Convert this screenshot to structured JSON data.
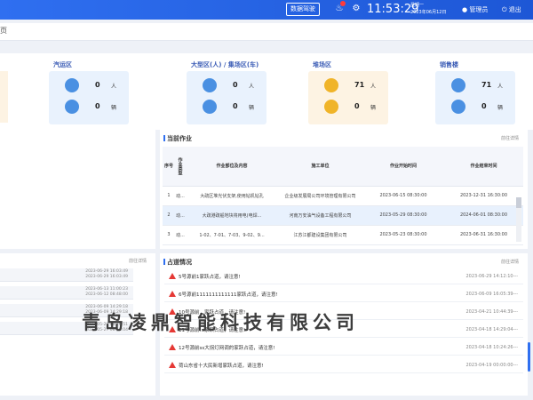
{
  "header": {
    "big_screen_label": "数据驾驶",
    "clock": "11:53:29",
    "date_line1": "星期一",
    "date_line2": "2023年06月12日",
    "user_label": "管理员",
    "exit_label": "退出",
    "brand_color": "#2f6ff0"
  },
  "tabbar": {
    "home_label": "页"
  },
  "stats": [
    {
      "title": "汽运区",
      "people": "0",
      "people_unit": "人",
      "vehicles": "0",
      "vehicles_unit": "辆",
      "card_color": "#e9f2fd",
      "icon_color": "#4a90e2"
    },
    {
      "title": "大型区(人) / 集场区(车)",
      "people": "0",
      "people_unit": "人",
      "vehicles": "0",
      "vehicles_unit": "辆",
      "card_color": "#e9f2fd",
      "icon_color": "#4a90e2"
    },
    {
      "title": "堆场区",
      "people": "71",
      "people_unit": "人",
      "vehicles": "0",
      "vehicles_unit": "辆",
      "card_color": "#fdf3e3",
      "icon_color": "#f0b429"
    },
    {
      "title": "销售楼",
      "people": "71",
      "people_unit": "人",
      "vehicles": "0",
      "vehicles_unit": "辆",
      "card_color": "#e9f2fd",
      "icon_color": "#4a90e2"
    }
  ],
  "current_work": {
    "title": "当前作业",
    "more": "前往详情",
    "columns": [
      "序号",
      "作业类型",
      "作业部位及内容",
      "施工单位",
      "作业开始时间",
      "作业结束时间"
    ],
    "rows": [
      {
        "no": "1",
        "type": "动...",
        "content": "大疏区堆光伏支架,使用钻机钻孔",
        "unit": "企业级发展局公司环境管理有限公司",
        "start": "2023-06-15 08:30:00",
        "end": "2023-12-31 16:30:00"
      },
      {
        "no": "2",
        "type": "动...",
        "content": "大疏港疏船地块将用电(电焊...",
        "unit": "河南万安油气设备工程有限公司",
        "start": "2023-05-29 08:30:00",
        "end": "2024-06-01 08:30:00"
      },
      {
        "no": "3",
        "type": "动...",
        "content": "1-02、7-01、7-03、9-02、9...",
        "unit": "江苏江都建设集团有限公司",
        "start": "2023-05-23 08:30:00",
        "end": "2023-06-31 16:30:00"
      }
    ]
  },
  "alarms": {
    "title": "占道情况",
    "more": "前往详情",
    "items": [
      {
        "text": "5号源前1家跃占道，请注意!",
        "time": "2023-06-29 14:12:10---"
      },
      {
        "text": "6号源前1111111111111家跃占道，请注意!",
        "time": "2023-06-09 16:05:39---"
      },
      {
        "text": "10号源前…家跃占道，请注意!",
        "time": "2023-04-21 10:44:39---"
      },
      {
        "text": "11号源前…家跃占道，请注意!",
        "time": "2023-04-18 14:29:04---"
      },
      {
        "text": "12号源前ss大拐灯网调的家跃占道，请注意!",
        "time": "2023-04-18 10:24:26---"
      },
      {
        "text": "荷山东省十大民新增家跃占道，请注意!",
        "time": "2023-04-19 00:00:00---"
      }
    ]
  },
  "left_list": {
    "more": "前往详情",
    "items": [
      {
        "t1": "2023-06-29 16:03:49",
        "t2": "2023-06-29 16:03:49"
      },
      {
        "t1": "2023-06-13 11:00:23",
        "t2": "2023-06-12 08:48:00"
      },
      {
        "t1": "2023-06-09 14:29:18",
        "t2": "2023-06-09 14:29:18"
      },
      {
        "t1": "2023-05-29 08:16:51",
        "t2": "2023-05-27 08:14:04"
      }
    ]
  },
  "watermark": "青岛凌鼎智能科技有限公司"
}
